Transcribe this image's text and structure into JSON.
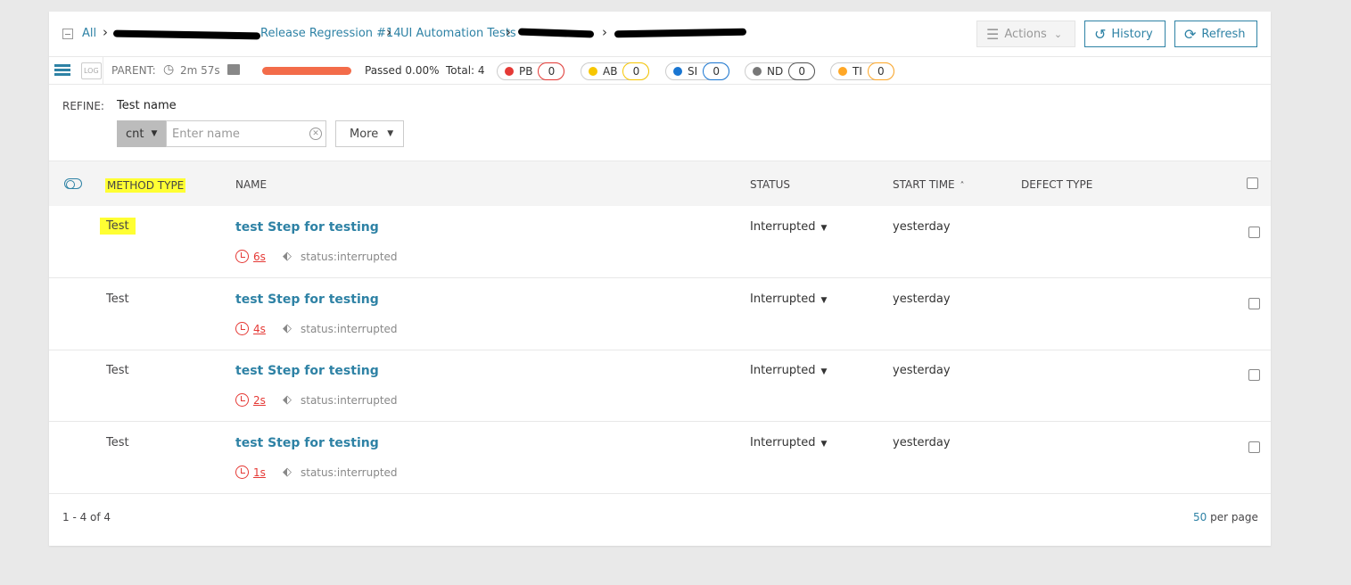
{
  "breadcrumb": {
    "all": "All",
    "launch": "Release Regression #14",
    "suite": "UI Automation Tests"
  },
  "toolbar": {
    "actions_label": "Actions",
    "history_label": "History",
    "refresh_label": "Refresh"
  },
  "infobar": {
    "parent_label": "PARENT:",
    "duration": "2m 57s",
    "passed": "Passed 0.00%",
    "total": "Total: 4",
    "progress_fraction": 0,
    "defects": [
      {
        "code": "PB",
        "count": "0",
        "color": "#e53935"
      },
      {
        "code": "AB",
        "count": "0",
        "color": "#f7c600"
      },
      {
        "code": "SI",
        "count": "0",
        "color": "#1976d2"
      },
      {
        "code": "ND",
        "count": "0",
        "color": "#777777"
      },
      {
        "code": "TI",
        "count": "0",
        "color": "#ffa726"
      }
    ]
  },
  "refine": {
    "label": "REFINE:",
    "field_label": "Test name",
    "condition": "cnt",
    "name_placeholder": "Enter name",
    "more_label": "More"
  },
  "table": {
    "headers": {
      "method_type": "METHOD TYPE",
      "name": "NAME",
      "status": "STATUS",
      "start_time": "START TIME",
      "sort_icon": "chevron-up-icon",
      "defect_type": "DEFECT TYPE"
    },
    "rows": [
      {
        "method_type": "Test",
        "name": "test Step for testing",
        "duration": "6s",
        "tag": "status:interrupted",
        "status": "Interrupted",
        "start_time": "yesterday",
        "highlighted": true
      },
      {
        "method_type": "Test",
        "name": "test Step for testing",
        "duration": "4s",
        "tag": "status:interrupted",
        "status": "Interrupted",
        "start_time": "yesterday",
        "highlighted": false
      },
      {
        "method_type": "Test",
        "name": "test Step for testing",
        "duration": "2s",
        "tag": "status:interrupted",
        "status": "Interrupted",
        "start_time": "yesterday",
        "highlighted": false
      },
      {
        "method_type": "Test",
        "name": "test Step for testing",
        "duration": "1s",
        "tag": "status:interrupted",
        "status": "Interrupted",
        "start_time": "yesterday",
        "highlighted": false
      }
    ]
  },
  "footer": {
    "range": "1 - 4 of 4",
    "per_page_value": "50",
    "per_page_label": "per page"
  },
  "colors": {
    "link": "#2e82a5",
    "failed_bar": "#f36c4a",
    "highlight": "#ffff33"
  }
}
